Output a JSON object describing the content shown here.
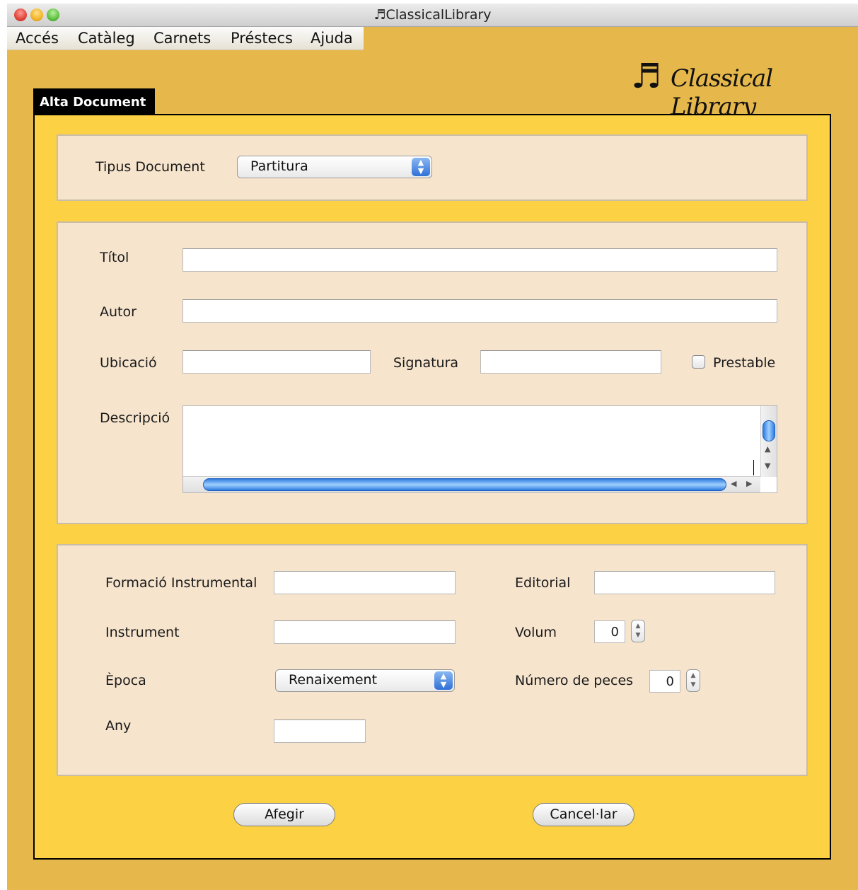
{
  "window": {
    "title": "ClassicalLibrary",
    "title_icon": "♬"
  },
  "menu": [
    "Accés",
    "Catàleg",
    "Carnets",
    "Préstecs",
    "Ajuda"
  ],
  "brand": {
    "icon": "♬",
    "text": "Classical Library"
  },
  "tab": {
    "label": "Alta Document"
  },
  "doc_type": {
    "label": "Tipus Document",
    "value": "Partitura"
  },
  "general": {
    "titol_label": "Títol",
    "autor_label": "Autor",
    "ubicacio_label": "Ubicació",
    "signatura_label": "Signatura",
    "prestable_label": "Prestable",
    "descripcio_label": "Descripció"
  },
  "details": {
    "formacio_label": "Formació  Instrumental",
    "editorial_label": "Editorial",
    "instrument_label": "Instrument",
    "volum_label": "Volum",
    "volum_value": "0",
    "epoca_label": "Època",
    "epoca_value": "Renaixement",
    "num_peces_label": "Número de peces",
    "num_peces_value": "0",
    "any_label": "Any"
  },
  "buttons": {
    "add": "Afegir",
    "cancel": "Cancel·lar"
  }
}
